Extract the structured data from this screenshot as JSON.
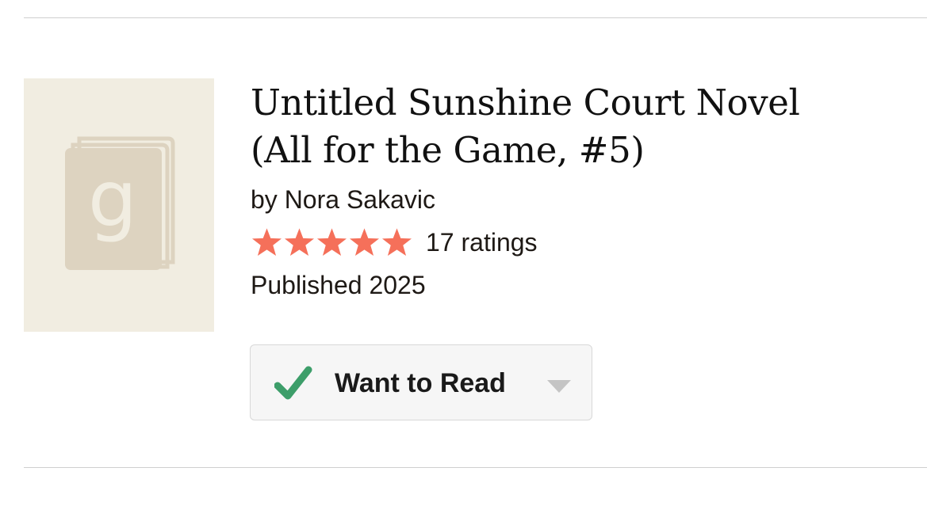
{
  "book": {
    "title_line1": "Untitled Sunshine Court Novel",
    "title_line2": "(All for the Game, #5)",
    "author": "by Nora Sakavic",
    "rating": {
      "stars": 5,
      "max_stars": 5,
      "star_color": "#f5705a"
    },
    "ratings_count": "17 ratings",
    "published": "Published 2025"
  },
  "cover": {
    "icon": "goodreads-placeholder-book-icon",
    "background_color": "#f1ede1",
    "icon_color": "#ddd3c0"
  },
  "shelf": {
    "label": "Want to Read",
    "check_icon": "check-icon",
    "check_color": "#3d9e6a",
    "dropdown_icon": "chevron-down-icon"
  }
}
